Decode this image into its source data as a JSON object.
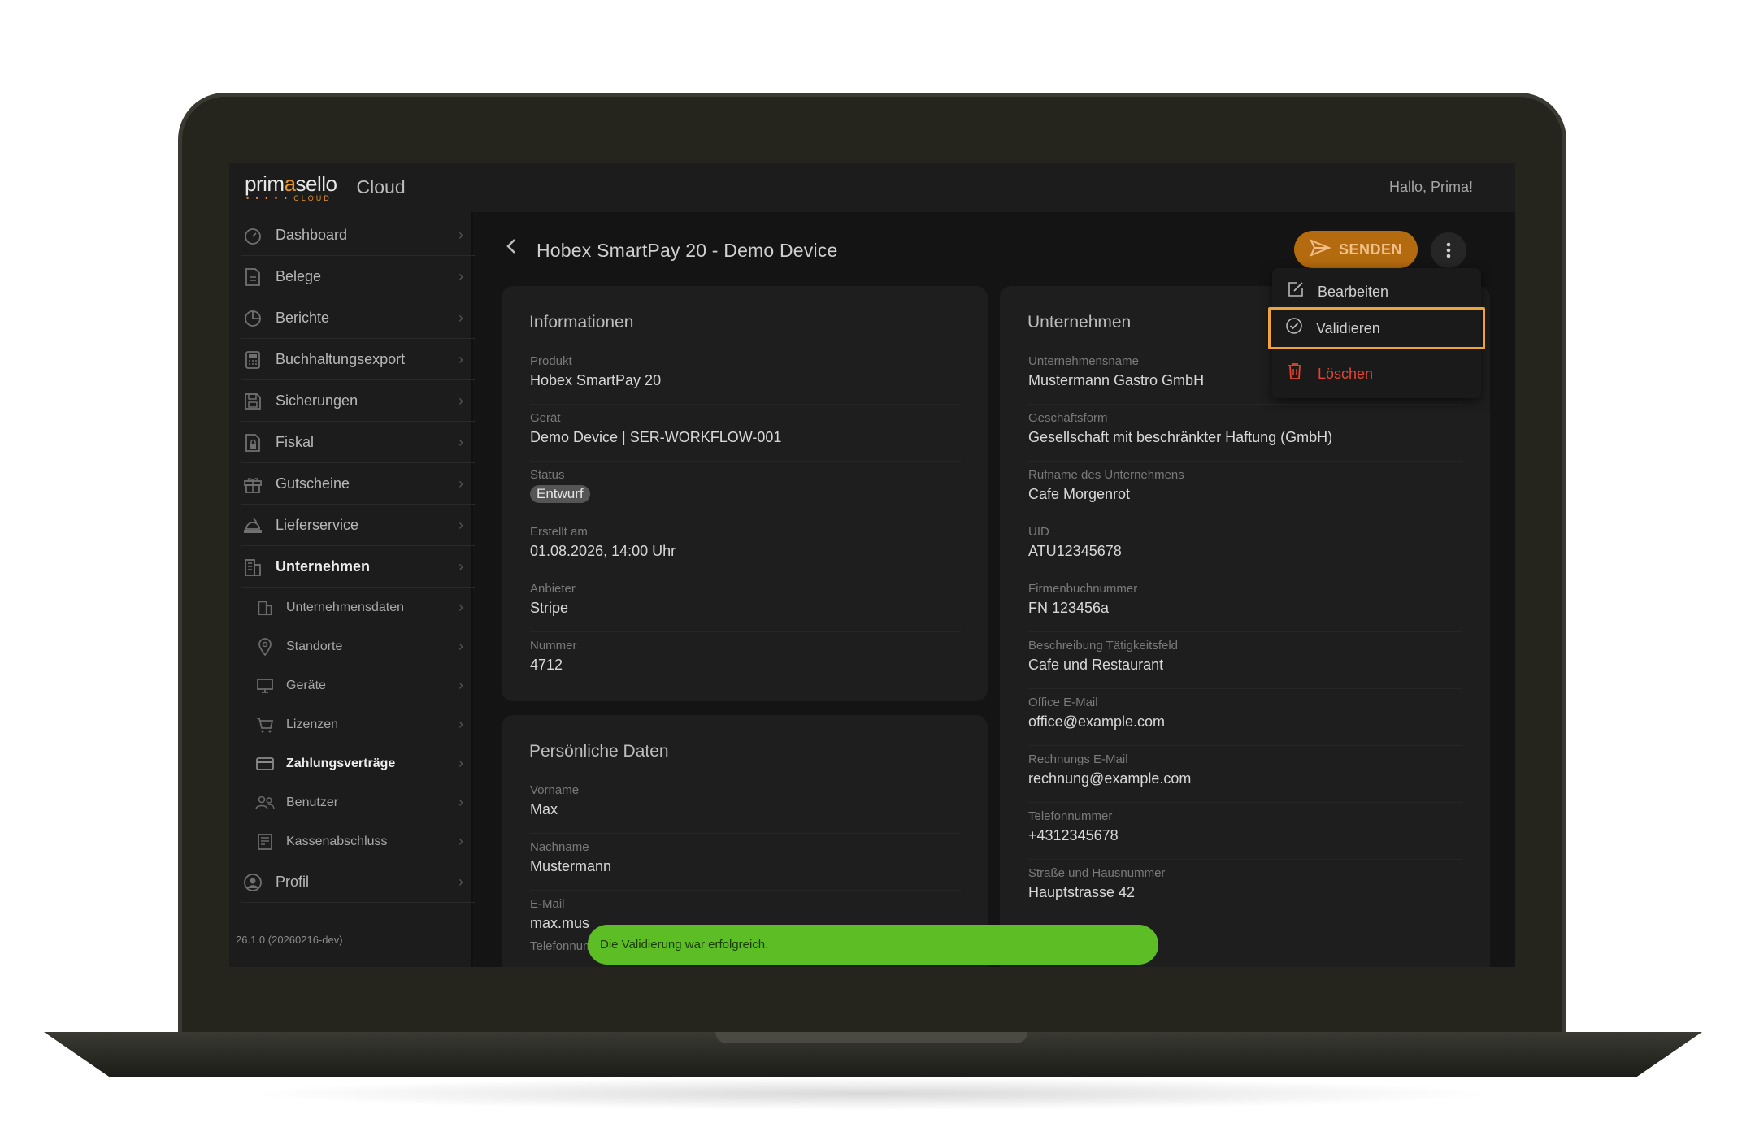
{
  "header": {
    "logo_text_1": "prim",
    "logo_text_a": "a",
    "logo_text_2": "sello",
    "logo_sub": "• • • • • CLOUD",
    "app_name": "Cloud",
    "greeting": "Hallo, Prima!"
  },
  "sidebar": {
    "items": [
      {
        "label": "Dashboard",
        "icon": "dashboard-icon"
      },
      {
        "label": "Belege",
        "icon": "document-icon"
      },
      {
        "label": "Berichte",
        "icon": "pie-chart-icon"
      },
      {
        "label": "Buchhaltungsexport",
        "icon": "calculator-icon"
      },
      {
        "label": "Sicherungen",
        "icon": "save-icon"
      },
      {
        "label": "Fiskal",
        "icon": "file-lock-icon"
      },
      {
        "label": "Gutscheine",
        "icon": "gift-icon"
      },
      {
        "label": "Lieferservice",
        "icon": "delivery-icon"
      },
      {
        "label": "Unternehmen",
        "icon": "building-icon"
      }
    ],
    "sub_items": [
      {
        "label": "Unternehmensdaten",
        "icon": "building-icon"
      },
      {
        "label": "Standorte",
        "icon": "location-pin-icon"
      },
      {
        "label": "Geräte",
        "icon": "device-icon"
      },
      {
        "label": "Lizenzen",
        "icon": "cart-icon"
      },
      {
        "label": "Zahlungsverträge",
        "icon": "credit-card-icon"
      },
      {
        "label": "Benutzer",
        "icon": "users-icon"
      },
      {
        "label": "Kassenabschluss",
        "icon": "register-icon"
      }
    ],
    "profile": {
      "label": "Profil",
      "icon": "user-circle-icon"
    },
    "version": "26.1.0 (20260216-dev)"
  },
  "main": {
    "title": "Hobex SmartPay 20 - Demo Device",
    "send_label": "SENDEN",
    "info_card": {
      "title": "Informationen",
      "fields": [
        {
          "label": "Produkt",
          "value": "Hobex SmartPay 20"
        },
        {
          "label": "Gerät",
          "value": "Demo Device | SER-WORKFLOW-001"
        },
        {
          "label": "Status",
          "value": "Entwurf"
        },
        {
          "label": "Erstellt am",
          "value": "01.08.2026, 14:00 Uhr"
        },
        {
          "label": "Anbieter",
          "value": "Stripe"
        },
        {
          "label": "Nummer",
          "value": "4712"
        }
      ]
    },
    "personal_card": {
      "title": "Persönliche Daten",
      "fields": [
        {
          "label": "Vorname",
          "value": "Max"
        },
        {
          "label": "Nachname",
          "value": "Mustermann"
        },
        {
          "label": "E-Mail",
          "value": "max.mus"
        },
        {
          "label": "Telefonnummer",
          "value": ""
        }
      ]
    },
    "company_card": {
      "title": "Unternehmen",
      "fields": [
        {
          "label": "Unternehmensname",
          "value": "Mustermann Gastro GmbH"
        },
        {
          "label": "Geschäftsform",
          "value": "Gesellschaft mit beschränkter Haftung (GmbH)"
        },
        {
          "label": "Rufname des Unternehmens",
          "value": "Cafe Morgenrot"
        },
        {
          "label": "UID",
          "value": "ATU12345678"
        },
        {
          "label": "Firmenbuchnummer",
          "value": "FN 123456a"
        },
        {
          "label": "Beschreibung Tätigkeitsfeld",
          "value": "Cafe und Restaurant"
        },
        {
          "label": "Office E-Mail",
          "value": "office@example.com"
        },
        {
          "label": "Rechnungs E-Mail",
          "value": "rechnung@example.com"
        },
        {
          "label": "Telefonnummer",
          "value": "+4312345678"
        },
        {
          "label": "Straße und Hausnummer",
          "value": "Hauptstrasse 42"
        }
      ]
    }
  },
  "menu": {
    "items": [
      {
        "label": "Bearbeiten",
        "icon": "edit-icon"
      },
      {
        "label": "Validieren",
        "icon": "check-circle-icon"
      },
      {
        "label": "Löschen",
        "icon": "trash-icon"
      }
    ]
  },
  "toast": {
    "message": "Die Validierung war erfolgreich."
  },
  "colors": {
    "accent": "#b46a0e",
    "highlight": "#f2a23a",
    "danger": "#e2452f",
    "success": "#5cbd24"
  }
}
